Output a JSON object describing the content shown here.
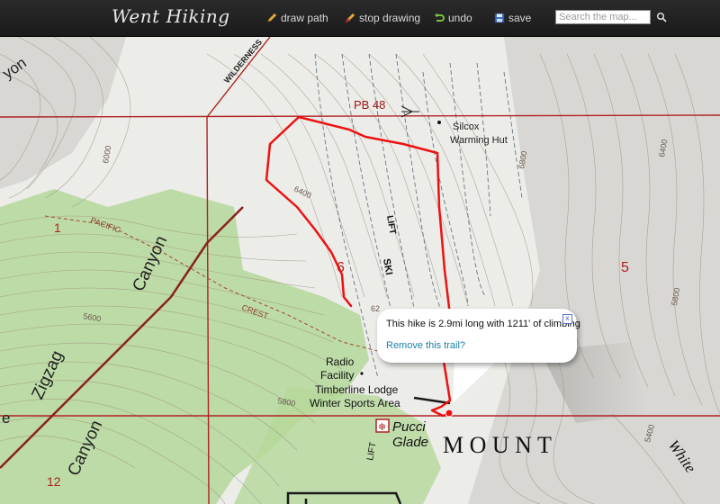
{
  "app": {
    "logo": "Went Hiking"
  },
  "toolbar": {
    "draw_path": "draw path",
    "stop_drawing": "stop drawing",
    "undo": "undo",
    "save": "save"
  },
  "search": {
    "placeholder": "Search the map..."
  },
  "popup": {
    "message": "This hike is 2.9mi long with 1211' of climbing",
    "remove_link": "Remove this trail?",
    "close": "x"
  },
  "map_labels": {
    "wilderness": "WILDERNESS",
    "pb48": "PB 48",
    "silcox": "Silcox",
    "warming_hut": "Warming Hut",
    "elev_6000": "6000",
    "elev_6400_a": "6400",
    "elev_6400_b": "6400",
    "elev_6800": "6800",
    "elev_5600": "5600",
    "elev_5800_a": "5800",
    "elev_5800_b": "5800",
    "elev_5400": "5400",
    "section_6": "6",
    "section_5": "5",
    "section_1": "1",
    "section_12": "12",
    "pacific": "PACIFIC",
    "crest": "CREST",
    "ski": "SKI",
    "lift": "LIFT",
    "lift_2": "LIFT",
    "canyon_a": "Canyon",
    "canyon_b": "Canyon",
    "zigzag": "Zigzag",
    "yon": "yon",
    "radio": "Radio",
    "facility": "Facility",
    "timberline": "Timberline Lodge",
    "winter_sports": "Winter Sports Area",
    "pucci": "Pucci",
    "glade": "Glade",
    "mount": "M O U N T",
    "white": "White",
    "frag_e": "e",
    "frag_62": "62"
  },
  "colors": {
    "trail": "#ee1111",
    "grid": "#b22020",
    "vegetation": "#a9cf8a",
    "terrain": "#ececea",
    "contour": "#9a8a7c"
  }
}
